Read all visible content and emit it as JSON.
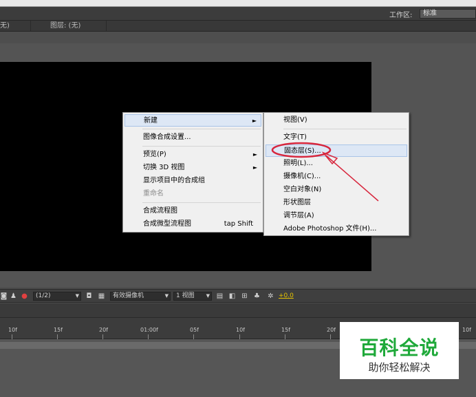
{
  "workspace": {
    "label": "工作区:",
    "selected": "标准"
  },
  "panel_tabs": {
    "composition": "无)",
    "layer": "图层: (无)"
  },
  "viewer_toolbar": {
    "resolution": "(1/2)",
    "camera": "有效摄像机",
    "views": "1 视图",
    "exposure_value": "+0.0"
  },
  "timeline_ruler": [
    "10f",
    "15f",
    "20f",
    "01:00f",
    "05f",
    "10f",
    "15f",
    "20f",
    "10f"
  ],
  "context_menu": {
    "items": [
      {
        "label": "新建",
        "has_submenu": true
      },
      {
        "label": "图像合成设置..."
      },
      {
        "label": "预览(P)",
        "has_submenu": true
      },
      {
        "label": "切换 3D 视图",
        "has_submenu": true
      },
      {
        "label": "显示项目中的合成组"
      },
      {
        "label": "重命名",
        "disabled": true
      },
      {
        "label": "合成流程图"
      },
      {
        "label": "合成微型流程图",
        "shortcut": "tap Shift"
      }
    ]
  },
  "submenu": {
    "items": [
      {
        "label": "视图(V)"
      },
      {
        "label": "文字(T)"
      },
      {
        "label": "固态层(S)..."
      },
      {
        "label": "照明(L)..."
      },
      {
        "label": "摄像机(C)..."
      },
      {
        "label": "空白对象(N)"
      },
      {
        "label": "形状图层"
      },
      {
        "label": "调节层(A)"
      },
      {
        "label": "Adobe Photoshop 文件(H)..."
      }
    ]
  },
  "watermark": {
    "title": "百科全说",
    "subtitle": "助你轻松解决"
  },
  "colors": {
    "annotation_red": "#d7263d",
    "watermark_green": "#1fa93a",
    "accent_yellow": "#e6c300"
  }
}
